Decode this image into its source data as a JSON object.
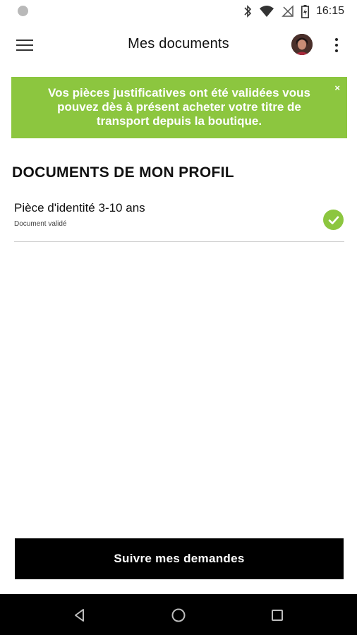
{
  "status_bar": {
    "time": "16:15"
  },
  "app_bar": {
    "title": "Mes documents"
  },
  "banner": {
    "message": "Vos pièces justificatives ont été validées vous pouvez dès à présent acheter votre titre de transport depuis la boutique.",
    "close_label": "×",
    "color": "#8cc63f"
  },
  "section": {
    "title": "DOCUMENTS DE MON PROFIL"
  },
  "documents": [
    {
      "name": "Pièce d'identité 3-10 ans",
      "status": "Document validé",
      "icon": "check-circle-icon"
    }
  ],
  "cta": {
    "label": "Suivre mes demandes"
  },
  "icons": {
    "menu": "hamburger-menu-icon",
    "more": "more-vert-icon",
    "back": "back-triangle-icon",
    "home": "home-circle-icon",
    "recents": "recents-square-icon"
  }
}
